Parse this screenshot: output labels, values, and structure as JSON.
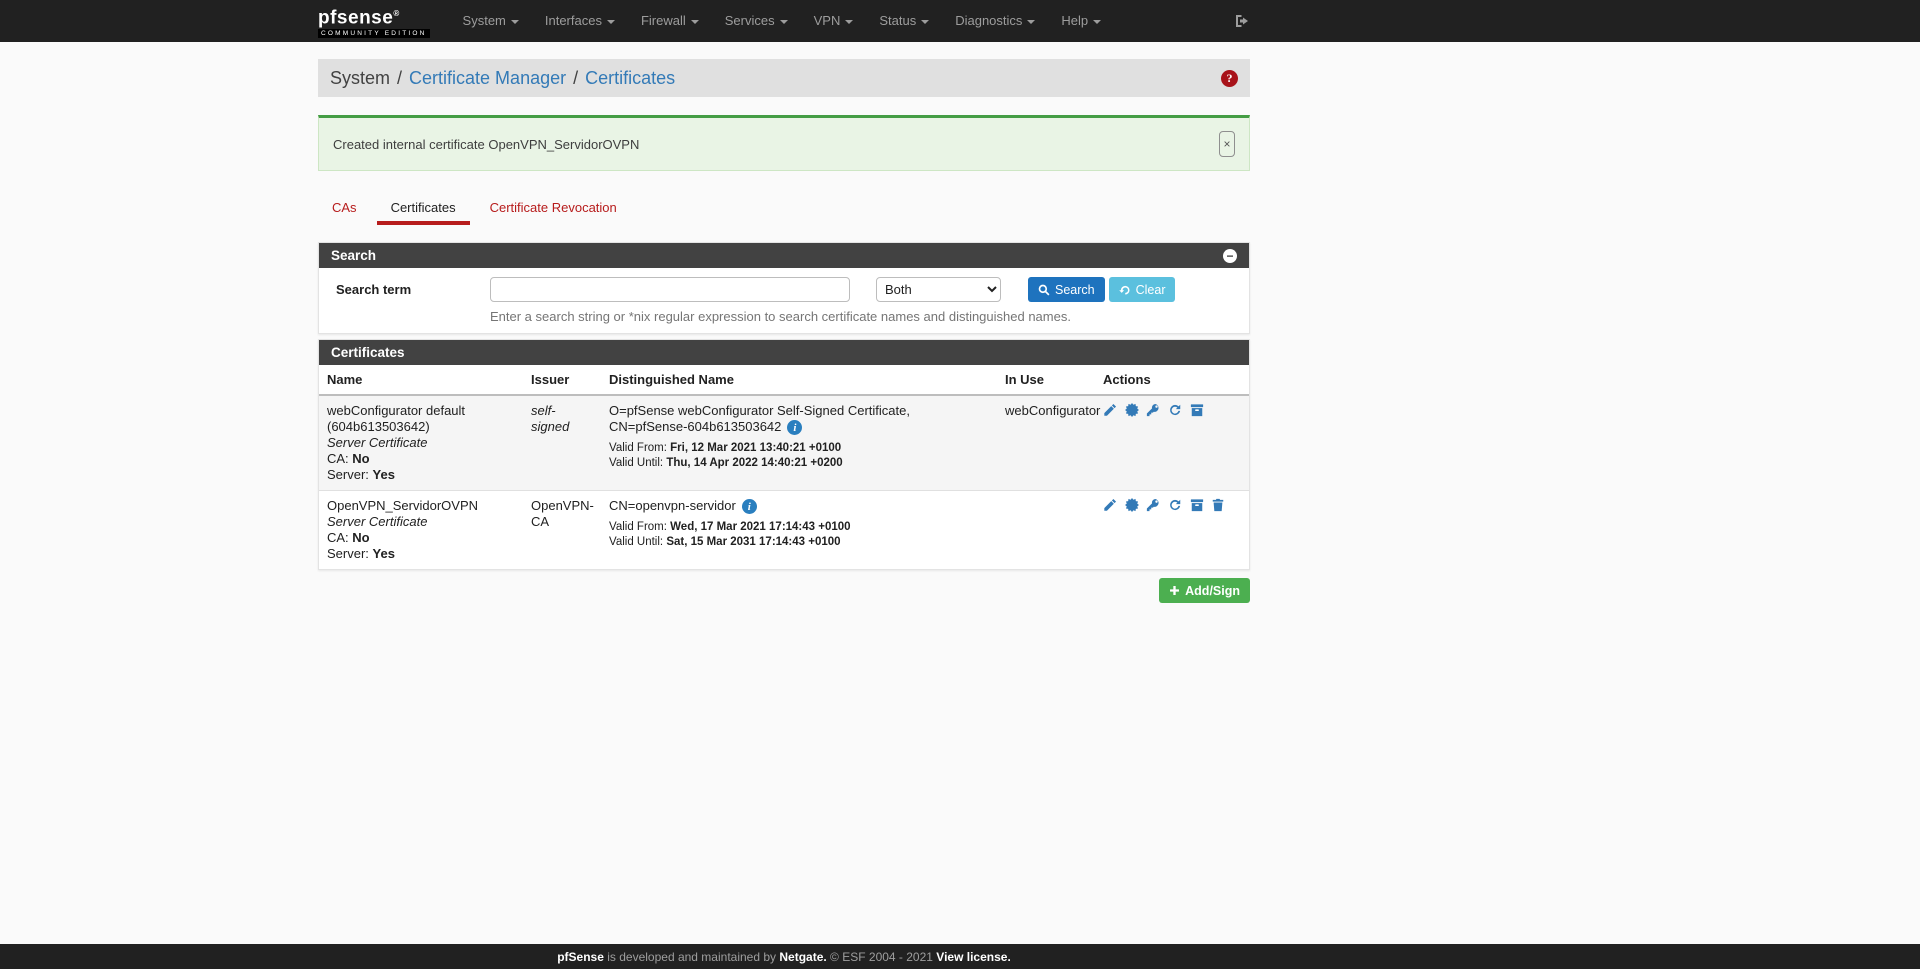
{
  "navbar": {
    "brand": {
      "name": "pfsense",
      "registered": "®",
      "edition": "COMMUNITY EDITION"
    },
    "items": [
      {
        "label": "System"
      },
      {
        "label": "Interfaces"
      },
      {
        "label": "Firewall"
      },
      {
        "label": "Services"
      },
      {
        "label": "VPN"
      },
      {
        "label": "Status"
      },
      {
        "label": "Diagnostics"
      },
      {
        "label": "Help"
      }
    ]
  },
  "breadcrumb": {
    "separator": "/",
    "section": "System",
    "links": [
      {
        "label": "Certificate Manager"
      },
      {
        "label": "Certificates"
      }
    ]
  },
  "alert": {
    "message": "Created internal certificate OpenVPN_ServidorOVPN"
  },
  "tabs": [
    {
      "label": "CAs"
    },
    {
      "label": "Certificates",
      "active": true
    },
    {
      "label": "Certificate Revocation"
    }
  ],
  "search": {
    "panel_title": "Search",
    "term_label": "Search term",
    "term_value": "",
    "scope_value": "Both",
    "search_button": "Search",
    "clear_button": "Clear",
    "hint": "Enter a search string or *nix regular expression to search certificate names and distinguished names."
  },
  "certificates": {
    "panel_title": "Certificates",
    "columns": [
      "Name",
      "Issuer",
      "Distinguished Name",
      "In Use",
      "Actions"
    ],
    "rows": [
      {
        "name": "webConfigurator default (604b613503642)",
        "type": "Server Certificate",
        "ca_label": "CA:",
        "ca_value": "No",
        "server_label": "Server:",
        "server_value": "Yes",
        "issuer": "self-signed",
        "dn": "O=pfSense webConfigurator Self-Signed Certificate, CN=pfSense-604b613503642",
        "valid_from_label": "Valid From:",
        "valid_from": "Fri, 12 Mar 2021 13:40:21 +0100",
        "valid_until_label": "Valid Until:",
        "valid_until": "Thu, 14 Apr 2022 14:40:21 +0200",
        "in_use": "webConfigurator",
        "actions": [
          "edit",
          "export-certificate",
          "export-private-key",
          "renew",
          "export-p12"
        ]
      },
      {
        "name": "OpenVPN_ServidorOVPN",
        "type": "Server Certificate",
        "ca_label": "CA:",
        "ca_value": "No",
        "server_label": "Server:",
        "server_value": "Yes",
        "issuer": "OpenVPN-CA",
        "dn": "CN=openvpn-servidor",
        "valid_from_label": "Valid From:",
        "valid_from": "Wed, 17 Mar 2021 17:14:43 +0100",
        "valid_until_label": "Valid Until:",
        "valid_until": "Sat, 15 Mar 2031 17:14:43 +0100",
        "in_use": "",
        "actions": [
          "edit",
          "export-certificate",
          "export-private-key",
          "renew",
          "export-p12",
          "delete"
        ]
      }
    ],
    "add_button": "Add/Sign"
  },
  "footer": {
    "brand": "pfSense",
    "text_1": " is developed and maintained by ",
    "netgate_link": "Netgate.",
    "text_2": " © ESF 2004 - 2021 ",
    "license_link": "View license."
  },
  "icons": {
    "info": "i",
    "help": "?",
    "collapse": "−",
    "close": "×"
  },
  "colors": {
    "accent_red": "#B71C1C",
    "link_blue": "#337AB7",
    "success_green": "#4CAF50",
    "panel_header": "#424242",
    "navbar": "#212121"
  }
}
